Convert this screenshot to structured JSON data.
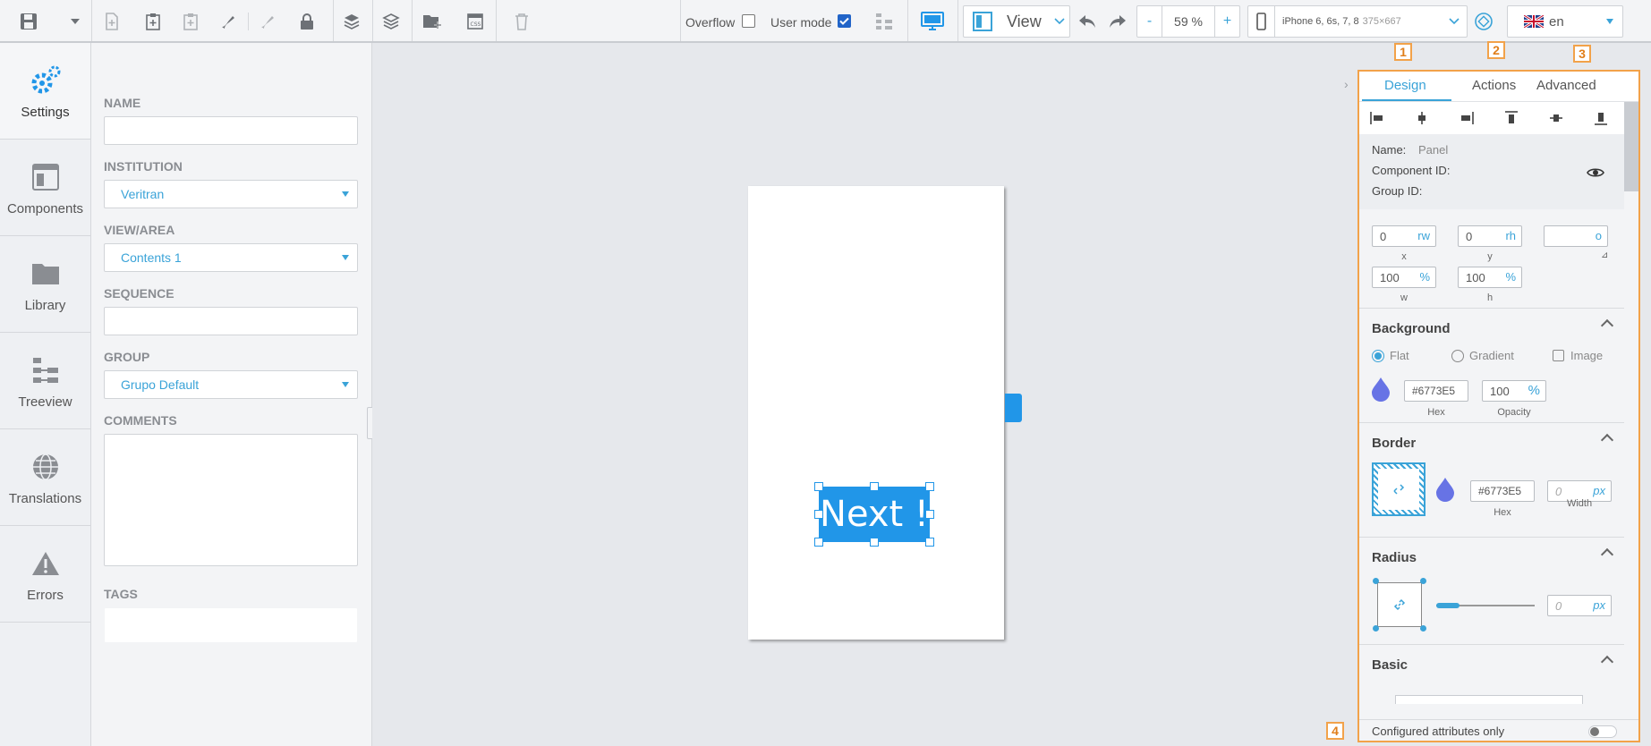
{
  "toolbar": {
    "overflow_label": "Overflow",
    "overflow_checked": false,
    "usermode_label": "User mode",
    "usermode_checked": true,
    "view_label": "View",
    "zoom_value": "59 %",
    "zoom_minus": "-",
    "zoom_plus": "+",
    "device_name": "iPhone 6, 6s, 7, 8",
    "device_size": "375×667",
    "language": "en"
  },
  "nav": [
    {
      "label": "Settings",
      "icon": "gear-icon"
    },
    {
      "label": "Components",
      "icon": "components-icon"
    },
    {
      "label": "Library",
      "icon": "folder-icon"
    },
    {
      "label": "Treeview",
      "icon": "treeview-icon"
    },
    {
      "label": "Translations",
      "icon": "globe-icon"
    },
    {
      "label": "Errors",
      "icon": "warning-icon"
    }
  ],
  "form": {
    "name_label": "NAME",
    "name_value": "",
    "institution_label": "INSTITUTION",
    "institution_value": "Veritran",
    "view_label": "VIEW/AREA",
    "view_value": "Contents 1",
    "sequence_label": "SEQUENCE",
    "sequence_value": "",
    "group_label": "GROUP",
    "group_value": "Grupo Default",
    "comments_label": "COMMENTS",
    "comments_value": "",
    "tags_label": "TAGS",
    "tags_value": ""
  },
  "canvas": {
    "button_text": "Next !"
  },
  "panel": {
    "tabs": [
      "Design",
      "Actions",
      "Advanced"
    ],
    "name_label": "Name:",
    "name_value": "Panel",
    "component_id_label": "Component ID:",
    "group_id_label": "Group ID:",
    "x_value": "0",
    "x_unit": "rw",
    "x_caption": "x",
    "y_value": "0",
    "y_unit": "rh",
    "y_caption": "y",
    "rot_unit": "o",
    "w_value": "100",
    "w_unit": "%",
    "w_caption": "w",
    "h_value": "100",
    "h_unit": "%",
    "h_caption": "h",
    "background_title": "Background",
    "bg_flat": "Flat",
    "bg_gradient": "Gradient",
    "bg_image": "Image",
    "bg_hex": "#6773E5",
    "bg_hex_caption": "Hex",
    "bg_opacity": "100",
    "bg_opacity_unit": "%",
    "bg_opacity_caption": "Opacity",
    "border_title": "Border",
    "border_hex": "#6773E5",
    "border_hex_caption": "Hex",
    "border_width": "0",
    "border_width_unit": "px",
    "border_width_caption": "Width",
    "radius_title": "Radius",
    "radius_value": "0",
    "radius_unit": "px",
    "basic_title": "Basic",
    "configured_label": "Configured attributes only"
  },
  "badges": [
    "1",
    "2",
    "3",
    "4"
  ],
  "colors": {
    "accent": "#3aa3d8",
    "button": "#2196e8",
    "swatch": "#6773E5",
    "highlight": "#f2a24a"
  }
}
